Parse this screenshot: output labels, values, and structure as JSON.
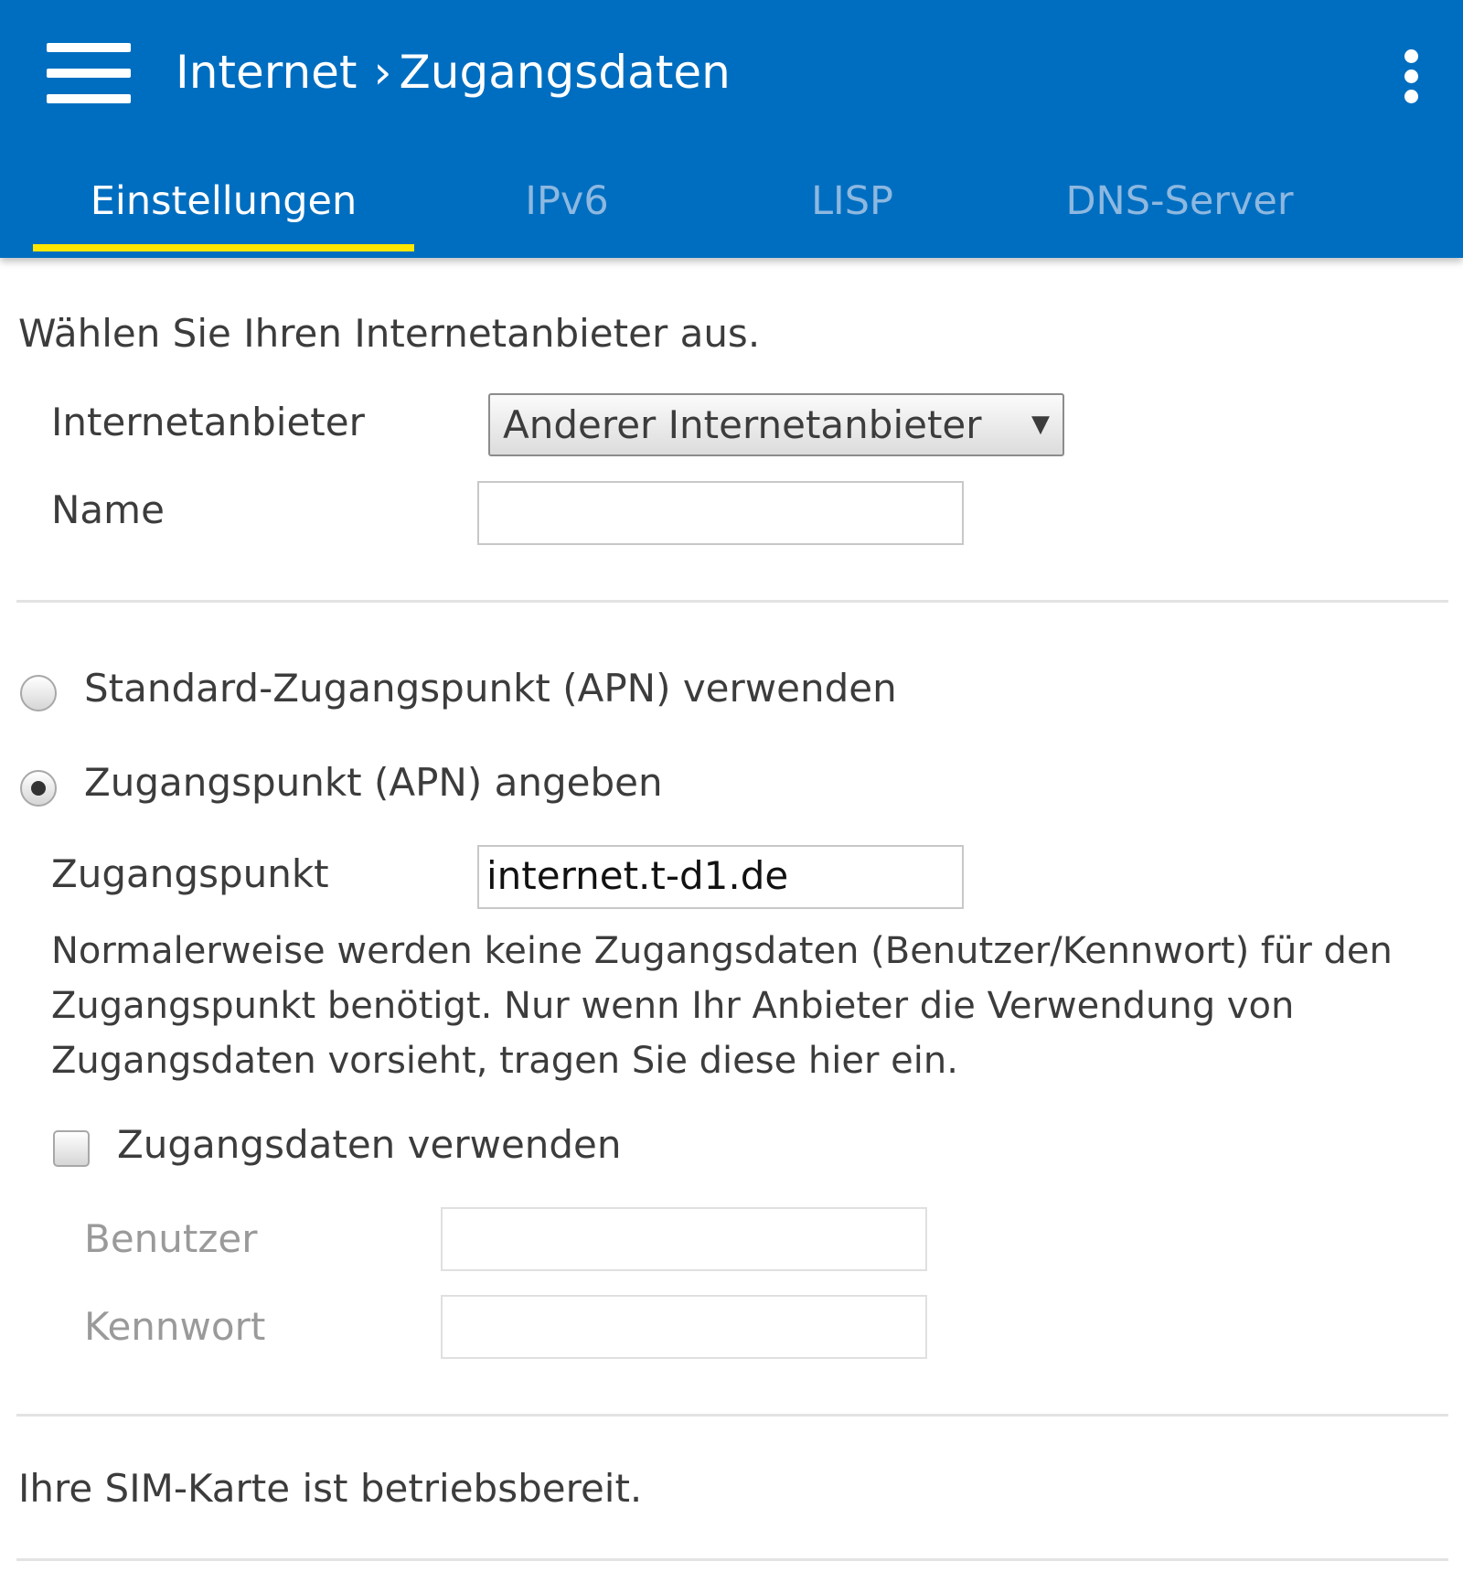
{
  "header": {
    "breadcrumb_parent": "Internet",
    "breadcrumb_separator": "›",
    "breadcrumb_current": "Zugangsdaten",
    "menu_icon": "hamburger-menu-icon",
    "overflow_icon": "more-vertical-icon"
  },
  "tabs": [
    {
      "label": "Einstellungen",
      "active": true
    },
    {
      "label": "IPv6",
      "active": false
    },
    {
      "label": "LISP",
      "active": false
    },
    {
      "label": "DNS-Server",
      "active": false
    }
  ],
  "colors": {
    "appbar": "#006ec0",
    "tab_indicator": "#ffe600",
    "tab_inactive_text": "#8db8e0"
  },
  "provider_section": {
    "intro": "Wählen Sie Ihren Internetanbieter aus.",
    "provider_label": "Internetanbieter",
    "provider_value": "Anderer Internetanbieter",
    "name_label": "Name",
    "name_value": ""
  },
  "apn_section": {
    "option_default": "Standard-Zugangspunkt (APN) verwenden",
    "option_custom": "Zugangspunkt (APN) angeben",
    "selected": "custom",
    "apn_label": "Zugangspunkt",
    "apn_value": "internet.t-d1.de",
    "info_text": "Normalerweise werden keine Zugangsdaten (Benutzer/Kennwort) für den Zugangspunkt benötigt. Nur wenn Ihr Anbieter die Verwendung von Zugangsdaten vorsieht, tragen Sie diese hier ein.",
    "use_credentials_label": "Zugangsdaten verwenden",
    "use_credentials_checked": false,
    "user_label": "Benutzer",
    "user_value": "",
    "password_label": "Kennwort",
    "password_value": ""
  },
  "sim_status": "Ihre SIM-Karte ist betriebsbereit."
}
